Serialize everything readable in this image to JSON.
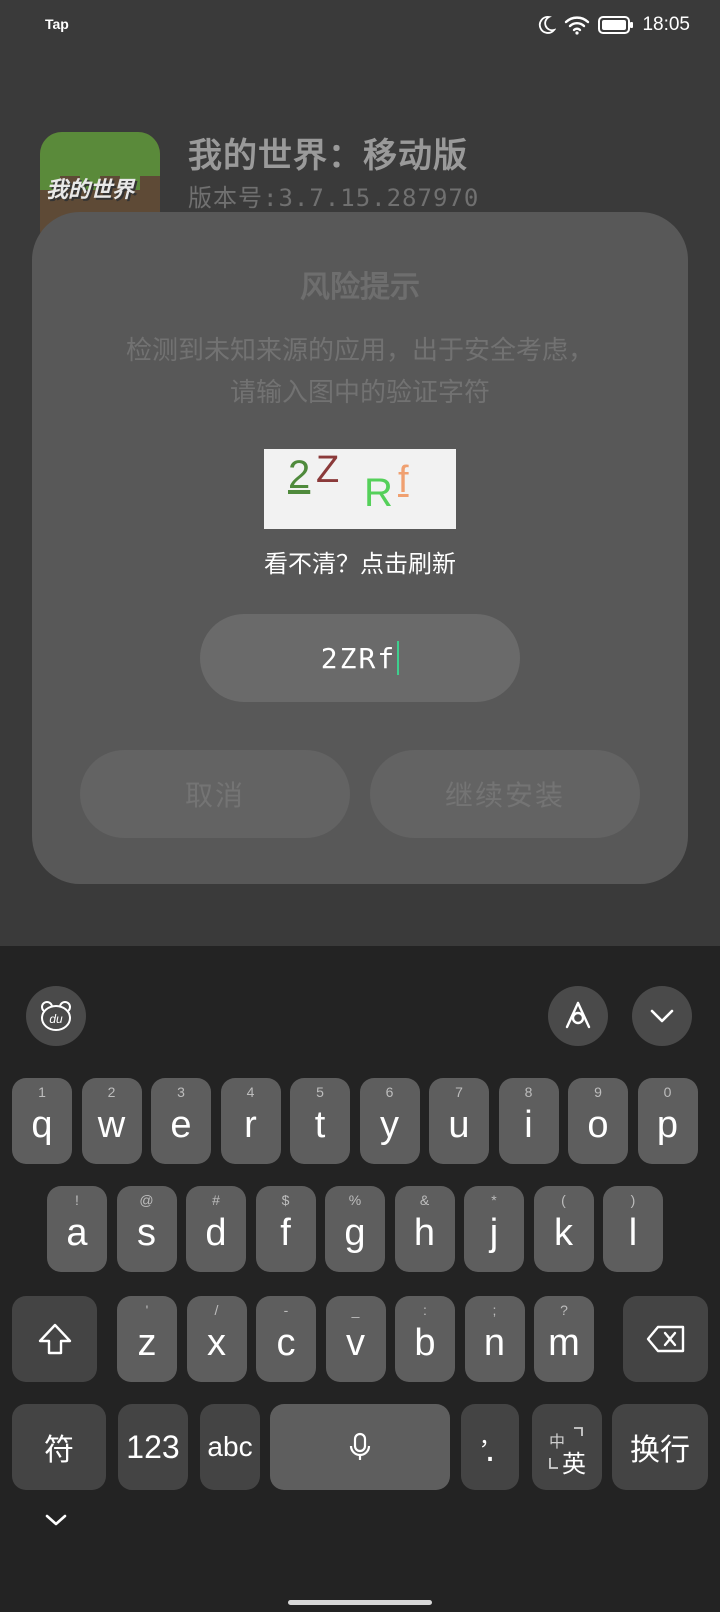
{
  "status_bar": {
    "app_label": "Tap",
    "time": "18:05"
  },
  "app": {
    "name": "我的世界：移动版",
    "version": "版本号:3.7.15.287970",
    "icon_text": "我的世界"
  },
  "dialog": {
    "title": "风险提示",
    "message_line1": "检测到未知来源的应用，出于安全考虑，",
    "message_line2": "请输入图中的验证字符",
    "captcha_chars": [
      "2",
      "Z",
      "R",
      "f"
    ],
    "refresh_text": "看不清？点击刷新",
    "input_value": "2ZRf",
    "cancel_label": "取消",
    "continue_label": "继续安装"
  },
  "keyboard": {
    "row1": [
      {
        "key": "q",
        "sub": "1"
      },
      {
        "key": "w",
        "sub": "2"
      },
      {
        "key": "e",
        "sub": "3"
      },
      {
        "key": "r",
        "sub": "4"
      },
      {
        "key": "t",
        "sub": "5"
      },
      {
        "key": "y",
        "sub": "6"
      },
      {
        "key": "u",
        "sub": "7"
      },
      {
        "key": "i",
        "sub": "8"
      },
      {
        "key": "o",
        "sub": "9"
      },
      {
        "key": "p",
        "sub": "0"
      }
    ],
    "row2": [
      {
        "key": "a",
        "sub": "!"
      },
      {
        "key": "s",
        "sub": "@"
      },
      {
        "key": "d",
        "sub": "#"
      },
      {
        "key": "f",
        "sub": "$"
      },
      {
        "key": "g",
        "sub": "%"
      },
      {
        "key": "h",
        "sub": "&"
      },
      {
        "key": "j",
        "sub": "*"
      },
      {
        "key": "k",
        "sub": "("
      },
      {
        "key": "l",
        "sub": ")"
      }
    ],
    "row3": [
      {
        "key": "z",
        "sub": "'"
      },
      {
        "key": "x",
        "sub": "/"
      },
      {
        "key": "c",
        "sub": "-"
      },
      {
        "key": "v",
        "sub": "_"
      },
      {
        "key": "b",
        "sub": ":"
      },
      {
        "key": "n",
        "sub": ";"
      },
      {
        "key": "m",
        "sub": "?"
      }
    ],
    "symbols_label": "符",
    "numbers_label": "123",
    "abc_label": "abc",
    "punct_main": ".",
    "punct_sub": "，",
    "lang_small": "中",
    "lang_big": "英",
    "enter_label": "换行"
  },
  "colors": {
    "accent_caret": "#3ecf8e",
    "dialog_bg": "#585858",
    "keyboard_bg": "#232323"
  },
  "icons": [
    "moon-icon",
    "wifi-icon",
    "battery-icon",
    "du-bear-icon",
    "ai-assistant-icon",
    "collapse-chevron-icon",
    "shift-icon",
    "backspace-icon",
    "mic-icon",
    "hide-keyboard-icon"
  ]
}
